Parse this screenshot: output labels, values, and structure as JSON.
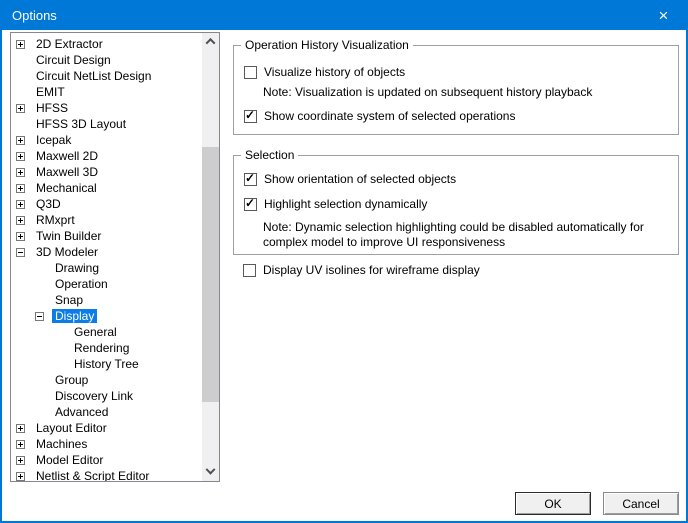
{
  "window": {
    "title": "Options",
    "close_glyph": "×"
  },
  "colors": {
    "accent": "#0078d7",
    "selection": "#0c7ce6",
    "scrollbar_thumb": "#cdcdcd",
    "scrollbar_track": "#f0f0f0"
  },
  "icons": {
    "checkmark": "✓",
    "close": "x-cross",
    "scroll_up": "chevron-up",
    "scroll_down": "chevron-down",
    "expand": "plus-box",
    "collapse": "minus-box"
  },
  "tree": {
    "items": [
      {
        "label": "2D Extractor",
        "level": 0,
        "exp": "plus",
        "selected": false
      },
      {
        "label": "Circuit Design",
        "level": 0,
        "exp": "none",
        "selected": false
      },
      {
        "label": "Circuit NetList Design",
        "level": 0,
        "exp": "none",
        "selected": false
      },
      {
        "label": "EMIT",
        "level": 0,
        "exp": "none",
        "selected": false
      },
      {
        "label": "HFSS",
        "level": 0,
        "exp": "plus",
        "selected": false
      },
      {
        "label": "HFSS 3D Layout",
        "level": 0,
        "exp": "none",
        "selected": false
      },
      {
        "label": "Icepak",
        "level": 0,
        "exp": "plus",
        "selected": false
      },
      {
        "label": "Maxwell 2D",
        "level": 0,
        "exp": "plus",
        "selected": false
      },
      {
        "label": "Maxwell 3D",
        "level": 0,
        "exp": "plus",
        "selected": false
      },
      {
        "label": "Mechanical",
        "level": 0,
        "exp": "plus",
        "selected": false
      },
      {
        "label": "Q3D",
        "level": 0,
        "exp": "plus",
        "selected": false
      },
      {
        "label": "RMxprt",
        "level": 0,
        "exp": "plus",
        "selected": false
      },
      {
        "label": "Twin Builder",
        "level": 0,
        "exp": "plus",
        "selected": false
      },
      {
        "label": "3D Modeler",
        "level": 0,
        "exp": "minus",
        "selected": false
      },
      {
        "label": "Drawing",
        "level": 1,
        "exp": "none",
        "selected": false
      },
      {
        "label": "Operation",
        "level": 1,
        "exp": "none",
        "selected": false
      },
      {
        "label": "Snap",
        "level": 1,
        "exp": "none",
        "selected": false
      },
      {
        "label": "Display",
        "level": 1,
        "exp": "minus",
        "selected": true
      },
      {
        "label": "General",
        "level": 2,
        "exp": "none",
        "selected": false
      },
      {
        "label": "Rendering",
        "level": 2,
        "exp": "none",
        "selected": false
      },
      {
        "label": "History Tree",
        "level": 2,
        "exp": "none",
        "selected": false
      },
      {
        "label": "Group",
        "level": 1,
        "exp": "none",
        "selected": false
      },
      {
        "label": "Discovery Link",
        "level": 1,
        "exp": "none",
        "selected": false
      },
      {
        "label": "Advanced",
        "level": 1,
        "exp": "none",
        "selected": false
      },
      {
        "label": "Layout Editor",
        "level": 0,
        "exp": "plus",
        "selected": false
      },
      {
        "label": "Machines",
        "level": 0,
        "exp": "plus",
        "selected": false
      },
      {
        "label": "Model Editor",
        "level": 0,
        "exp": "plus",
        "selected": false
      },
      {
        "label": "Netlist & Script Editor",
        "level": 0,
        "exp": "plus",
        "selected": false
      }
    ]
  },
  "panel": {
    "groups": [
      {
        "title": "Operation History Visualization",
        "rows": [
          {
            "type": "checkbox",
            "checked": false,
            "label": "Visualize history of objects"
          },
          {
            "type": "note",
            "text": "Note: Visualization is updated on subsequent history playback"
          },
          {
            "type": "checkbox",
            "checked": true,
            "label": "Show coordinate system of selected operations"
          }
        ]
      },
      {
        "title": "Selection",
        "rows": [
          {
            "type": "checkbox",
            "checked": true,
            "label": "Show orientation of selected objects"
          },
          {
            "type": "checkbox",
            "checked": true,
            "label": "Highlight selection dynamically"
          },
          {
            "type": "note",
            "text": "Note: Dynamic selection highlighting could be disabled automatically for complex model to improve UI responsiveness"
          }
        ]
      }
    ],
    "standalone": {
      "type": "checkbox",
      "checked": false,
      "label": "Display UV isolines for wireframe display"
    }
  },
  "buttons": {
    "ok": "OK",
    "cancel": "Cancel"
  }
}
